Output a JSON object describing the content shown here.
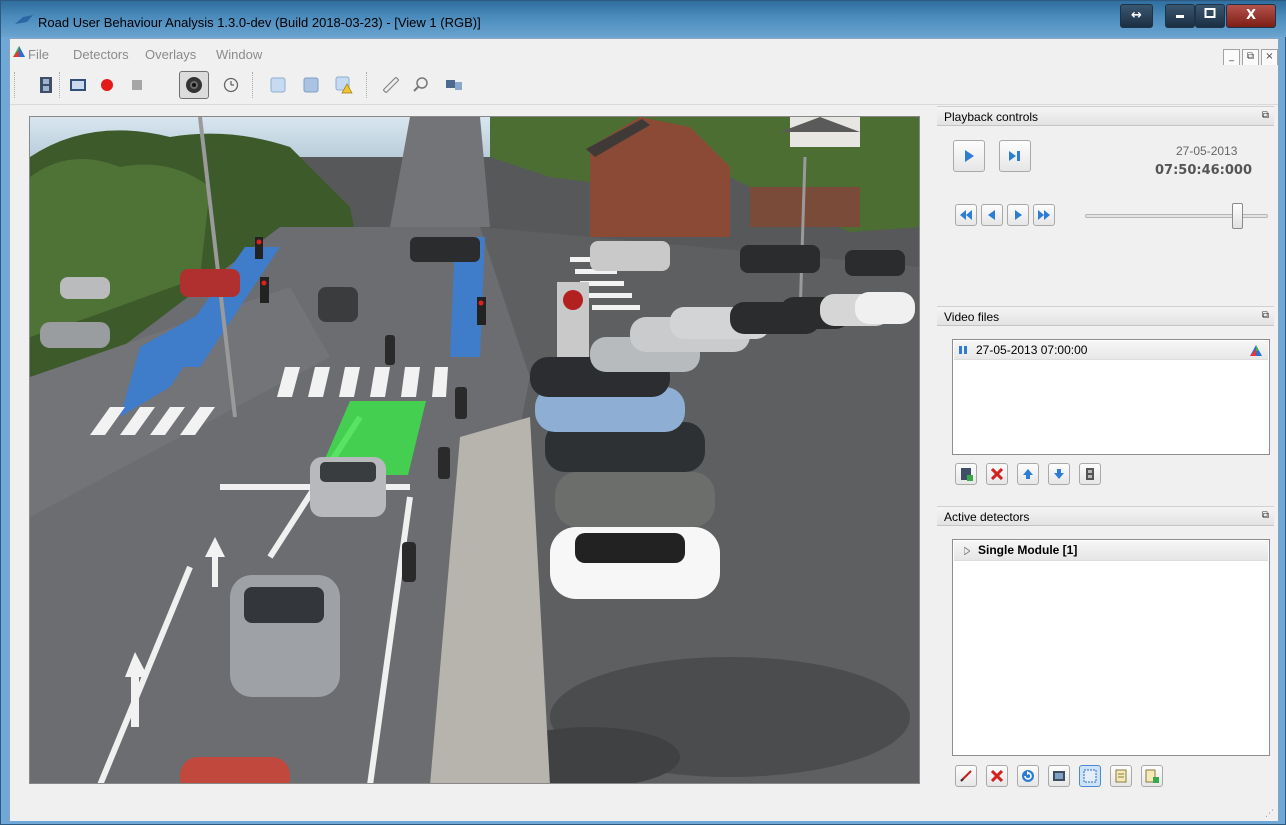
{
  "window": {
    "title": "Road User Behaviour Analysis 1.3.0-dev (Build 2018-03-23) - [View 1 (RGB)]",
    "controls": {
      "resize": "↔",
      "minimize": "▁",
      "maximize": "□",
      "close": "X"
    }
  },
  "menubar": {
    "items": [
      "File",
      "Detectors",
      "Overlays",
      "Window"
    ],
    "mdi_controls": {
      "minimize": "_",
      "restore": "⧉",
      "close": "×"
    }
  },
  "toolbar": {
    "icons": [
      "film-icon",
      "display-icon",
      "record-icon",
      "stop-icon",
      "camera-icon",
      "clock-icon",
      "rect-icon",
      "rect-shade-icon",
      "rect-warn-icon",
      "ruler-icon",
      "zoom-icon",
      "screens-icon"
    ],
    "active": "camera-icon"
  },
  "playback": {
    "title": "Playback controls",
    "date": "27-05-2013",
    "time": "07:50:46:000",
    "slider_value": 0.86
  },
  "video_files": {
    "title": "Video files",
    "items": [
      {
        "label": "27-05-2013 07:00:00"
      }
    ]
  },
  "active_detectors": {
    "title": "Active detectors",
    "items": [
      {
        "label": "Single Module [1]"
      }
    ]
  },
  "colors": {
    "title_bar": "#4b8cbd",
    "chrome": "#f0f0f0",
    "accent_blue": "#2d7dd2",
    "detection_green": "#3ee04a"
  }
}
